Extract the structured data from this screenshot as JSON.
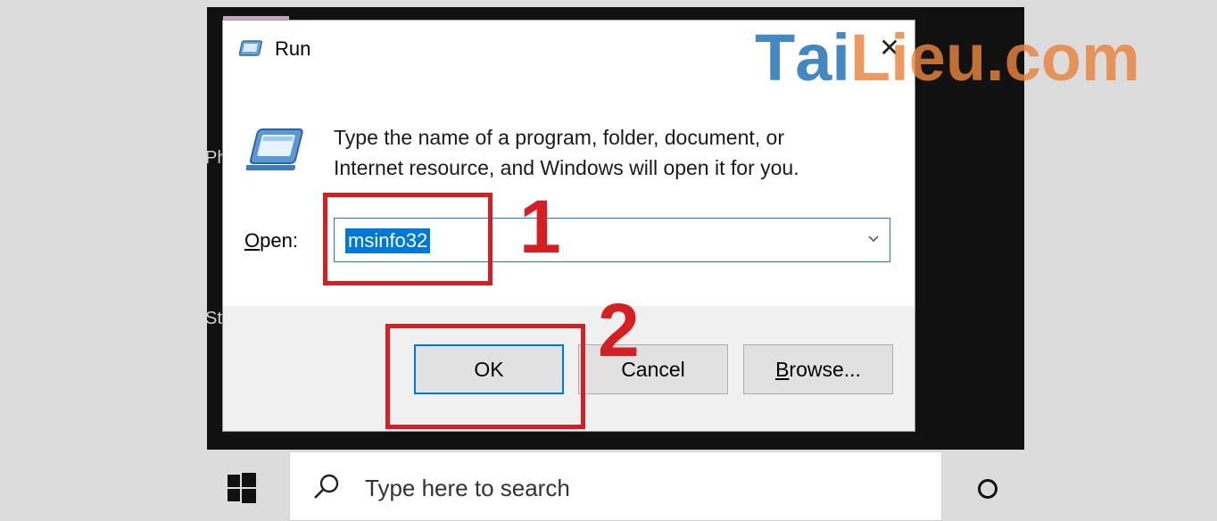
{
  "dialog": {
    "title": "Run",
    "close_glyph": "✕",
    "description_line1": "Type the name of a program, folder, document, or",
    "description_line2": "Internet resource, and Windows will open it for you.",
    "open_label_hotkey": "O",
    "open_label_rest": "pen:",
    "input_value": "msinfo32",
    "buttons": {
      "ok": "OK",
      "cancel": "Cancel",
      "browse_hotkey": "B",
      "browse_rest": "rowse..."
    }
  },
  "annotations": {
    "step1": "1",
    "step2": "2",
    "color": "#d42023"
  },
  "watermark": {
    "t": "T",
    "ai": "ai",
    "lieu": "Lieu",
    "com": ".com",
    "blue": "#1b6fb5",
    "orange": "#e8843d"
  },
  "background_text": {
    "left_top": "Ph",
    "left_bottom": "St"
  },
  "taskbar": {
    "search_placeholder": "Type here to search",
    "start_icon": "windows-logo-icon",
    "cortana_icon": "cortana-circle-icon"
  },
  "colors": {
    "accent": "#0078d7",
    "selection": "#0078d7"
  }
}
